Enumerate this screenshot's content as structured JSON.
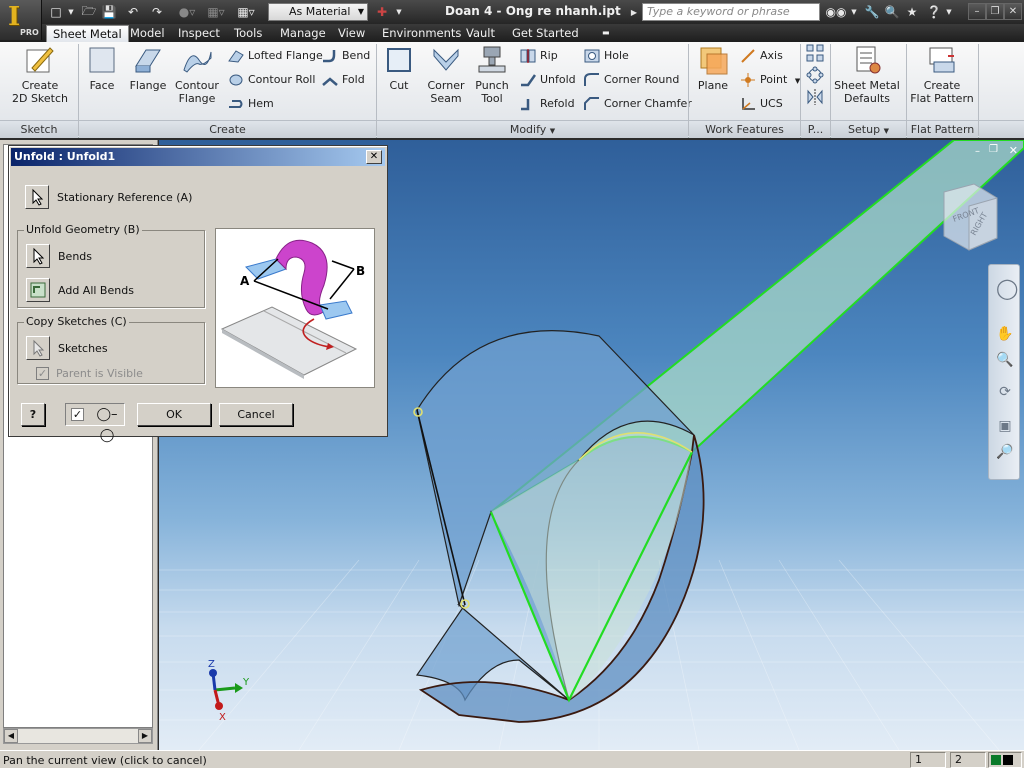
{
  "app": {
    "logo_letter": "I",
    "logo_badge": "PRO",
    "document_title": "Doan 4 - Ong re nhanh.ipt",
    "material": "As Material",
    "search_placeholder": "Type a keyword or phrase"
  },
  "tabs": [
    "Sheet Metal",
    "Model",
    "Inspect",
    "Tools",
    "Manage",
    "View",
    "Environments",
    "Vault",
    "Get Started"
  ],
  "ribbon": {
    "sketch": {
      "label": "Sketch",
      "create_2d_sketch": [
        "Create",
        "2D Sketch"
      ]
    },
    "create": {
      "label": "Create",
      "face": "Face",
      "flange": "Flange",
      "contour_flange": [
        "Contour",
        "Flange"
      ],
      "lofted_flange": "Lofted Flange",
      "contour_roll": "Contour Roll",
      "hem": "Hem",
      "bend": "Bend",
      "fold": "Fold"
    },
    "modify": {
      "label": "Modify",
      "cut": "Cut",
      "corner_seam": [
        "Corner",
        "Seam"
      ],
      "punch_tool": [
        "Punch",
        "Tool"
      ],
      "rip": "Rip",
      "unfold": "Unfold",
      "refold": "Refold",
      "hole": "Hole",
      "corner_round": "Corner Round",
      "corner_chamfer": "Corner Chamfer"
    },
    "work_features": {
      "label": "Work Features",
      "plane": "Plane",
      "axis": "Axis",
      "point": "Point",
      "ucs": "UCS"
    },
    "pattern": {
      "label": "P..."
    },
    "setup": {
      "label": "Setup",
      "sheet_metal_defaults": [
        "Sheet Metal",
        "Defaults"
      ]
    },
    "flat_pattern": {
      "label": "Flat Pattern",
      "create_flat_pattern": [
        "Create",
        "Flat Pattern"
      ]
    }
  },
  "dialog": {
    "title": "Unfold : Unfold1",
    "stationary_reference": "Stationary Reference (A)",
    "unfold_geometry_group": "Unfold Geometry (B)",
    "bends": "Bends",
    "add_all_bends": "Add All Bends",
    "copy_sketches_group": "Copy Sketches (C)",
    "sketches": "Sketches",
    "parent_is_visible": "Parent is Visible",
    "parent_is_visible_checked": true,
    "preview_checked": true,
    "ok": "OK",
    "cancel": "Cancel",
    "help": "?",
    "illustration_labels": {
      "a": "A",
      "b": "B"
    }
  },
  "viewcube": {
    "front": "FRONT",
    "right": "RIGHT"
  },
  "axes": {
    "x": "X",
    "y": "Y",
    "z": "Z"
  },
  "statusbar": {
    "message": "Pan the current view (click to cancel)",
    "count1": "1",
    "count2": "2"
  },
  "colors": {
    "accent": "#0a246a",
    "selection_green": "#22dd22",
    "part_blue": "#6f9fcf",
    "part_green_face": "#a8d8c8"
  }
}
